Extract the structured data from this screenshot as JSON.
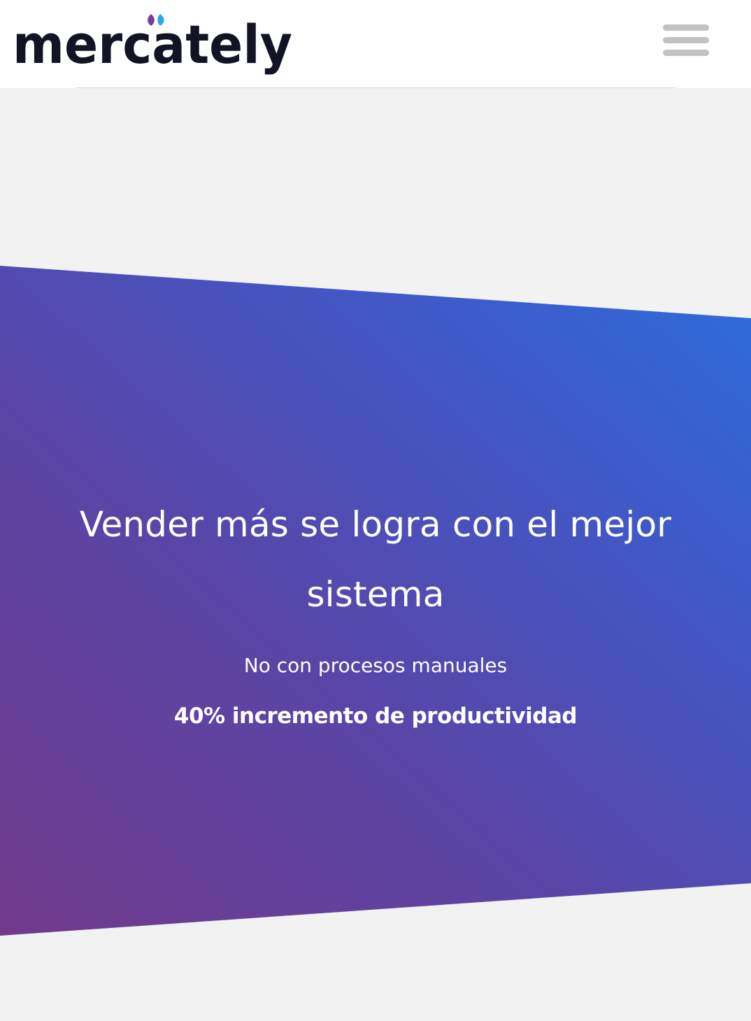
{
  "header": {
    "brand": "mercately",
    "menu_icon": "hamburger-menu-icon"
  },
  "hero": {
    "title": "Vender más se logra con el mejor sistema",
    "subtitle": "No con procesos manuales",
    "highlight": "40% incremento de productividad"
  },
  "colors": {
    "background": "#f2f2f2",
    "header_background": "#ffffff",
    "brand_text": "#131326",
    "brand_dot_purple": "#7d3a9a",
    "brand_dot_blue": "#2ba7ea",
    "hero_gradient_start": "#713a8c",
    "hero_gradient_end": "#2b6ddb",
    "menu_icon": "#c2c2c2"
  }
}
